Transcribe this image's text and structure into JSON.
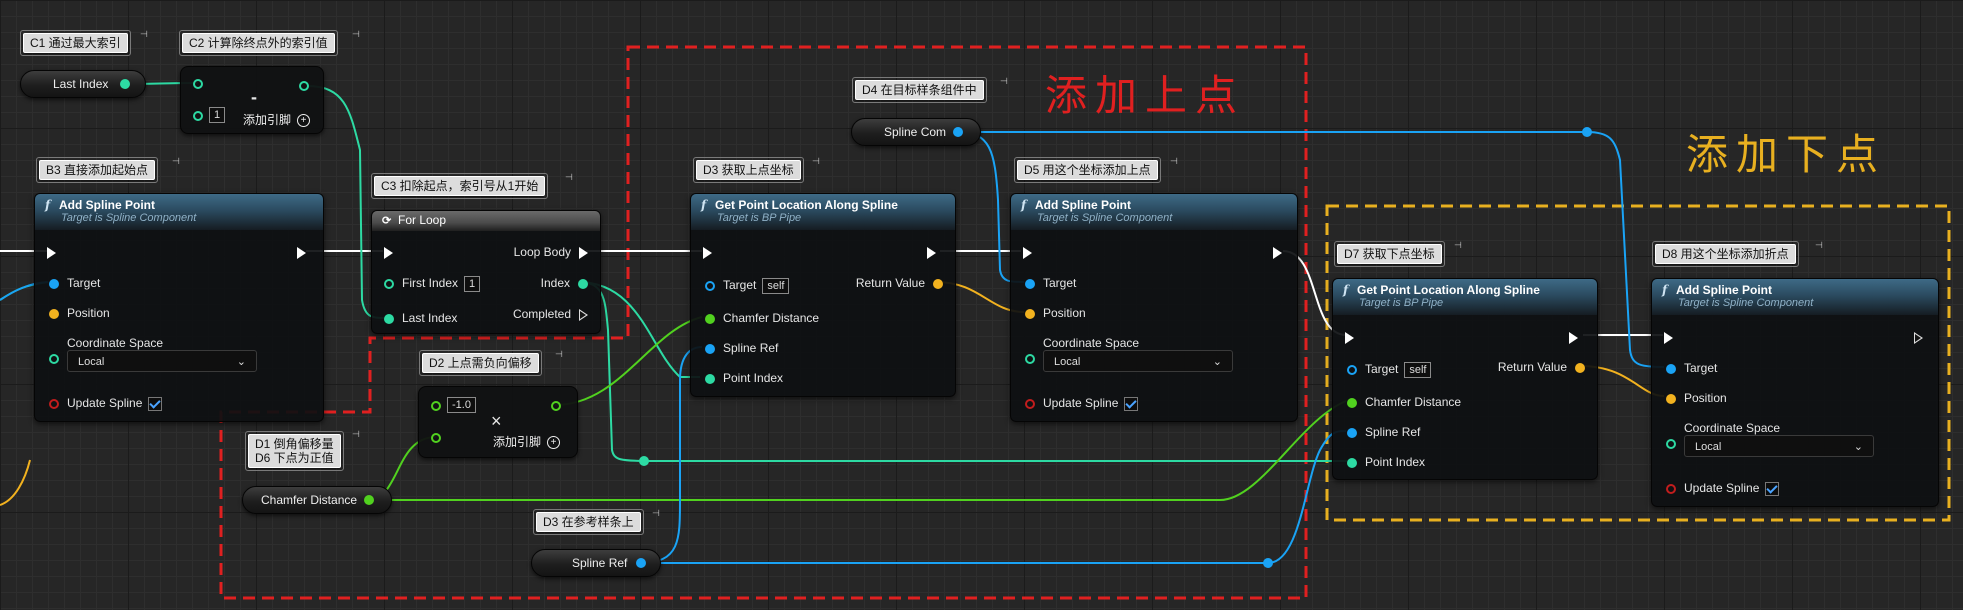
{
  "regions": {
    "add_upper": {
      "label": "添加上点",
      "color": "#e02020"
    },
    "add_lower": {
      "label": "添加下点",
      "color": "#e8b020"
    }
  },
  "comments": {
    "c1": "C1 通过最大索引",
    "c2": "C2 计算除终点外的索引值",
    "b3": "B3 直接添加起始点",
    "c3": "C3 扣除起点，索引号从1开始",
    "d3a": "D3 获取上点坐标",
    "d4": "D4 在目标样条组件中",
    "d5": "D5 用这个坐标添加上点",
    "d2": "D2 上点需负向偏移",
    "d1": "D1 倒角偏移量\nD6 下点为正值",
    "d3b": "D3 在参考样条上",
    "d7": "D7 获取下点坐标",
    "d8": "D8 用这个坐标添加折点"
  },
  "variables": {
    "last_index": "Last Index",
    "spline_com": "Spline Com",
    "chamfer_distance": "Chamfer Distance",
    "spline_ref": "Spline Ref"
  },
  "subtract_node": {
    "symbol": "-",
    "value": "1",
    "add_pin": "添加引脚"
  },
  "multiply_node": {
    "symbol": "×",
    "value": "-1.0",
    "add_pin": "添加引脚"
  },
  "add_spline_point": {
    "title": "Add Spline Point",
    "subtitle": "Target is Spline Component",
    "target": "Target",
    "position": "Position",
    "coordinate_space": "Coordinate Space",
    "coordinate_value": "Local",
    "update_spline": "Update Spline"
  },
  "get_point_location": {
    "title": "Get Point Location Along Spline",
    "subtitle": "Target is BP Pipe",
    "target": "Target",
    "self": "self",
    "return_value": "Return Value",
    "chamfer_distance": "Chamfer Distance",
    "spline_ref": "Spline Ref",
    "point_index": "Point Index"
  },
  "for_loop": {
    "title": "For Loop",
    "first_index": "First Index",
    "first_index_value": "1",
    "last_index": "Last Index",
    "loop_body": "Loop Body",
    "index": "Index",
    "completed": "Completed"
  },
  "colors": {
    "exec": "#ffffff",
    "integer": "#2ddaa3",
    "float": "#51d11f",
    "object": "#1aa3f5",
    "vector": "#f2b21f",
    "bool": "#c21d1d"
  }
}
